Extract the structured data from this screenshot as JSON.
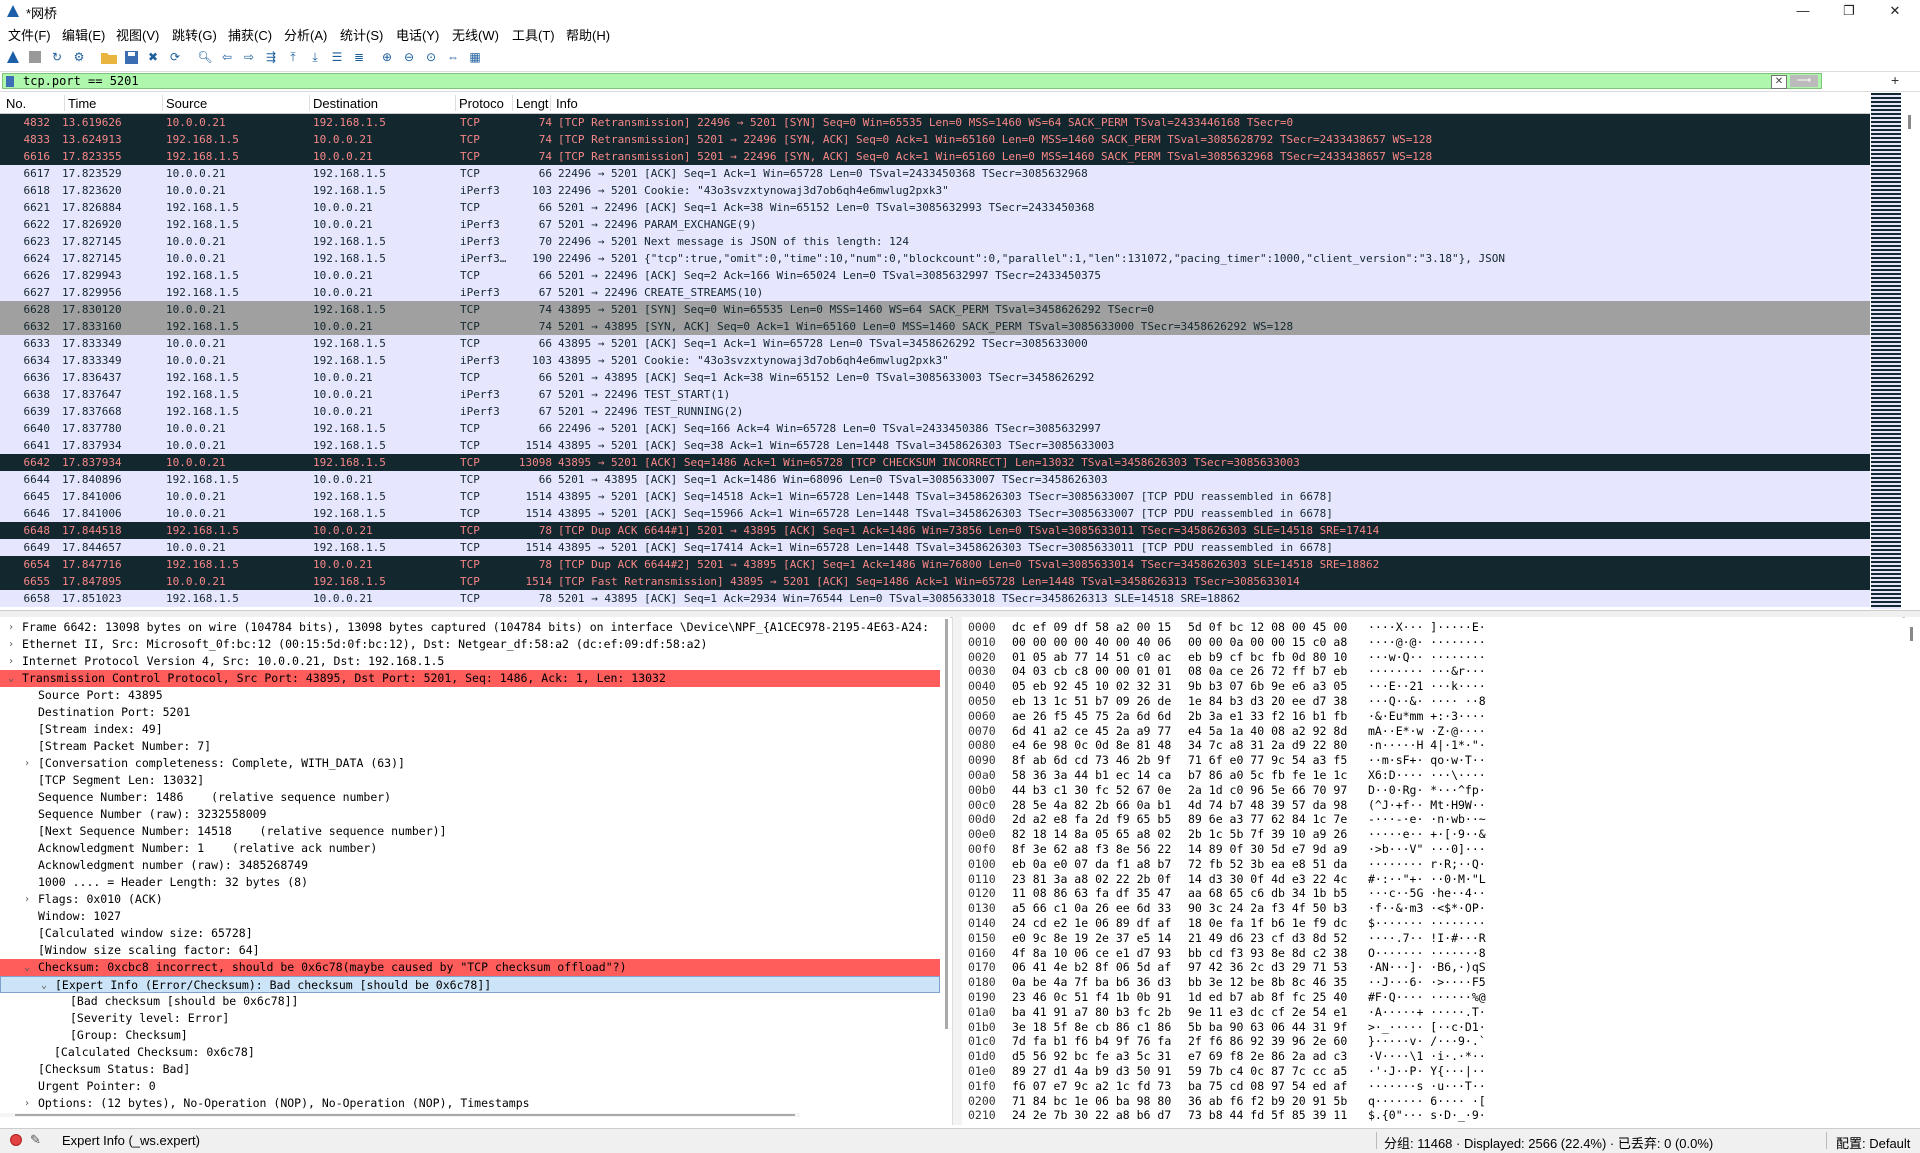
{
  "window": {
    "title": "*网桥",
    "minimize": "—",
    "maximize": "❐",
    "close": "✕"
  },
  "menu": [
    "文件(F)",
    "编辑(E)",
    "视图(V)",
    "跳转(G)",
    "捕获(C)",
    "分析(A)",
    "统计(S)",
    "电话(Y)",
    "无线(W)",
    "工具(T)",
    "帮助(H)"
  ],
  "toolbar_icons": [
    "shark-fin-start-icon",
    "stop-icon",
    "restart-icon",
    "options-gear-icon",
    "open-folder-icon",
    "save-icon",
    "close-file-icon",
    "reload-icon",
    "find-icon",
    "back-icon",
    "forward-icon",
    "go-to-packet-icon",
    "first-packet-icon",
    "last-packet-icon",
    "autoscroll-icon",
    "colorize-icon",
    "zoom-in-icon",
    "zoom-out-icon",
    "zoom-reset-icon",
    "resize-columns-icon",
    "layout-icon"
  ],
  "filter": {
    "value": "tcp.port == 5201",
    "clear": "✕",
    "apply": "⟶",
    "add": "+"
  },
  "columns": {
    "no": "No.",
    "time": "Time",
    "source": "Source",
    "destination": "Destination",
    "protocol": "Protoco",
    "length": "Lengt",
    "info": "Info"
  },
  "packets": [
    {
      "no": "4832",
      "time": "13.619626",
      "src": "10.0.0.21",
      "dst": "192.168.1.5",
      "proto": "TCP",
      "len": "74",
      "info": "[TCP Retransmission] 22496 → 5201 [SYN] Seq=0 Win=65535 Len=0 MSS=1460 WS=64 SACK_PERM TSval=2433446168 TSecr=0",
      "style": "bad"
    },
    {
      "no": "4833",
      "time": "13.624913",
      "src": "192.168.1.5",
      "dst": "10.0.0.21",
      "proto": "TCP",
      "len": "74",
      "info": "[TCP Retransmission] 5201 → 22496 [SYN, ACK] Seq=0 Ack=1 Win=65160 Len=0 MSS=1460 SACK_PERM TSval=3085628792 TSecr=2433438657 WS=128",
      "style": "bad"
    },
    {
      "no": "6616",
      "time": "17.823355",
      "src": "192.168.1.5",
      "dst": "10.0.0.21",
      "proto": "TCP",
      "len": "74",
      "info": "[TCP Retransmission] 5201 → 22496 [SYN, ACK] Seq=0 Ack=1 Win=65160 Len=0 MSS=1460 SACK_PERM TSval=3085632968 TSecr=2433438657 WS=128",
      "style": "bad"
    },
    {
      "no": "6617",
      "time": "17.823529",
      "src": "10.0.0.21",
      "dst": "192.168.1.5",
      "proto": "TCP",
      "len": "66",
      "info": "22496 → 5201 [ACK] Seq=1 Ack=1 Win=65728 Len=0 TSval=2433450368 TSecr=3085632968",
      "style": "tcp"
    },
    {
      "no": "6618",
      "time": "17.823620",
      "src": "10.0.0.21",
      "dst": "192.168.1.5",
      "proto": "iPerf3",
      "len": "103",
      "info": "22496 → 5201 Cookie: \"43o3svzxtynowaj3d7ob6qh4e6mwlug2pxk3\"",
      "style": "tcp"
    },
    {
      "no": "6621",
      "time": "17.826884",
      "src": "192.168.1.5",
      "dst": "10.0.0.21",
      "proto": "TCP",
      "len": "66",
      "info": "5201 → 22496 [ACK] Seq=1 Ack=38 Win=65152 Len=0 TSval=3085632993 TSecr=2433450368",
      "style": "tcp"
    },
    {
      "no": "6622",
      "time": "17.826920",
      "src": "192.168.1.5",
      "dst": "10.0.0.21",
      "proto": "iPerf3",
      "len": "67",
      "info": "5201 → 22496 PARAM_EXCHANGE(9)",
      "style": "tcp"
    },
    {
      "no": "6623",
      "time": "17.827145",
      "src": "10.0.0.21",
      "dst": "192.168.1.5",
      "proto": "iPerf3",
      "len": "70",
      "info": "22496 → 5201 Next message is JSON of this length: 124",
      "style": "tcp"
    },
    {
      "no": "6624",
      "time": "17.827145",
      "src": "10.0.0.21",
      "dst": "192.168.1.5",
      "proto": "iPerf3…",
      "len": "190",
      "info": "22496 → 5201 {\"tcp\":true,\"omit\":0,\"time\":10,\"num\":0,\"blockcount\":0,\"parallel\":1,\"len\":131072,\"pacing_timer\":1000,\"client_version\":\"3.18\"}, JSON",
      "style": "tcp"
    },
    {
      "no": "6626",
      "time": "17.829943",
      "src": "192.168.1.5",
      "dst": "10.0.0.21",
      "proto": "TCP",
      "len": "66",
      "info": "5201 → 22496 [ACK] Seq=2 Ack=166 Win=65024 Len=0 TSval=3085632997 TSecr=2433450375",
      "style": "tcp"
    },
    {
      "no": "6627",
      "time": "17.829956",
      "src": "192.168.1.5",
      "dst": "10.0.0.21",
      "proto": "iPerf3",
      "len": "67",
      "info": "5201 → 22496 CREATE_STREAMS(10)",
      "style": "tcp"
    },
    {
      "no": "6628",
      "time": "17.830120",
      "src": "10.0.0.21",
      "dst": "192.168.1.5",
      "proto": "TCP",
      "len": "74",
      "info": "43895 → 5201 [SYN] Seq=0 Win=65535 Len=0 MSS=1460 WS=64 SACK_PERM TSval=3458626292 TSecr=0",
      "style": "syn"
    },
    {
      "no": "6632",
      "time": "17.833160",
      "src": "192.168.1.5",
      "dst": "10.0.0.21",
      "proto": "TCP",
      "len": "74",
      "info": "5201 → 43895 [SYN, ACK] Seq=0 Ack=1 Win=65160 Len=0 MSS=1460 SACK_PERM TSval=3085633000 TSecr=3458626292 WS=128",
      "style": "syn"
    },
    {
      "no": "6633",
      "time": "17.833349",
      "src": "10.0.0.21",
      "dst": "192.168.1.5",
      "proto": "TCP",
      "len": "66",
      "info": "43895 → 5201 [ACK] Seq=1 Ack=1 Win=65728 Len=0 TSval=3458626292 TSecr=3085633000",
      "style": "tcp"
    },
    {
      "no": "6634",
      "time": "17.833349",
      "src": "10.0.0.21",
      "dst": "192.168.1.5",
      "proto": "iPerf3",
      "len": "103",
      "info": "43895 → 5201 Cookie: \"43o3svzxtynowaj3d7ob6qh4e6mwlug2pxk3\"",
      "style": "tcp"
    },
    {
      "no": "6636",
      "time": "17.836437",
      "src": "192.168.1.5",
      "dst": "10.0.0.21",
      "proto": "TCP",
      "len": "66",
      "info": "5201 → 43895 [ACK] Seq=1 Ack=38 Win=65152 Len=0 TSval=3085633003 TSecr=3458626292",
      "style": "tcp"
    },
    {
      "no": "6638",
      "time": "17.837647",
      "src": "192.168.1.5",
      "dst": "10.0.0.21",
      "proto": "iPerf3",
      "len": "67",
      "info": "5201 → 22496 TEST_START(1)",
      "style": "tcp"
    },
    {
      "no": "6639",
      "time": "17.837668",
      "src": "192.168.1.5",
      "dst": "10.0.0.21",
      "proto": "iPerf3",
      "len": "67",
      "info": "5201 → 22496 TEST_RUNNING(2)",
      "style": "tcp"
    },
    {
      "no": "6640",
      "time": "17.837780",
      "src": "10.0.0.21",
      "dst": "192.168.1.5",
      "proto": "TCP",
      "len": "66",
      "info": "22496 → 5201 [ACK] Seq=166 Ack=4 Win=65728 Len=0 TSval=2433450386 TSecr=3085632997",
      "style": "tcp"
    },
    {
      "no": "6641",
      "time": "17.837934",
      "src": "10.0.0.21",
      "dst": "192.168.1.5",
      "proto": "TCP",
      "len": "1514",
      "info": "43895 → 5201 [ACK] Seq=38 Ack=1 Win=65728 Len=1448 TSval=3458626303 TSecr=3085633003",
      "style": "tcp"
    },
    {
      "no": "6642",
      "time": "17.837934",
      "src": "10.0.0.21",
      "dst": "192.168.1.5",
      "proto": "TCP",
      "len": "13098",
      "info": "43895 → 5201 [ACK] Seq=1486 Ack=1 Win=65728 [TCP CHECKSUM INCORRECT] Len=13032 TSval=3458626303 TSecr=3085633003",
      "style": "bad"
    },
    {
      "no": "6644",
      "time": "17.840896",
      "src": "192.168.1.5",
      "dst": "10.0.0.21",
      "proto": "TCP",
      "len": "66",
      "info": "5201 → 43895 [ACK] Seq=1 Ack=1486 Win=68096 Len=0 TSval=3085633007 TSecr=3458626303",
      "style": "tcp"
    },
    {
      "no": "6645",
      "time": "17.841006",
      "src": "10.0.0.21",
      "dst": "192.168.1.5",
      "proto": "TCP",
      "len": "1514",
      "info": "43895 → 5201 [ACK] Seq=14518 Ack=1 Win=65728 Len=1448 TSval=3458626303 TSecr=3085633007 [TCP PDU reassembled in 6678]",
      "style": "tcp"
    },
    {
      "no": "6646",
      "time": "17.841006",
      "src": "10.0.0.21",
      "dst": "192.168.1.5",
      "proto": "TCP",
      "len": "1514",
      "info": "43895 → 5201 [ACK] Seq=15966 Ack=1 Win=65728 Len=1448 TSval=3458626303 TSecr=3085633007 [TCP PDU reassembled in 6678]",
      "style": "tcp"
    },
    {
      "no": "6648",
      "time": "17.844518",
      "src": "192.168.1.5",
      "dst": "10.0.0.21",
      "proto": "TCP",
      "len": "78",
      "info": "[TCP Dup ACK 6644#1] 5201 → 43895 [ACK] Seq=1 Ack=1486 Win=73856 Len=0 TSval=3085633011 TSecr=3458626303 SLE=14518 SRE=17414",
      "style": "bad"
    },
    {
      "no": "6649",
      "time": "17.844657",
      "src": "10.0.0.21",
      "dst": "192.168.1.5",
      "proto": "TCP",
      "len": "1514",
      "info": "43895 → 5201 [ACK] Seq=17414 Ack=1 Win=65728 Len=1448 TSval=3458626303 TSecr=3085633011 [TCP PDU reassembled in 6678]",
      "style": "tcp"
    },
    {
      "no": "6654",
      "time": "17.847716",
      "src": "192.168.1.5",
      "dst": "10.0.0.21",
      "proto": "TCP",
      "len": "78",
      "info": "[TCP Dup ACK 6644#2] 5201 → 43895 [ACK] Seq=1 Ack=1486 Win=76800 Len=0 TSval=3085633014 TSecr=3458626303 SLE=14518 SRE=18862",
      "style": "bad"
    },
    {
      "no": "6655",
      "time": "17.847895",
      "src": "10.0.0.21",
      "dst": "192.168.1.5",
      "proto": "TCP",
      "len": "1514",
      "info": "[TCP Fast Retransmission] 43895 → 5201 [ACK] Seq=1486 Ack=1 Win=65728 Len=1448 TSval=3458626313 TSecr=3085633014",
      "style": "bad"
    },
    {
      "no": "6658",
      "time": "17.851023",
      "src": "192.168.1.5",
      "dst": "10.0.0.21",
      "proto": "TCP",
      "len": "78",
      "info": "5201 → 43895 [ACK] Seq=1 Ack=2934 Win=76544 Len=0 TSval=3085633018 TSecr=3458626313 SLE=14518 SRE=18862",
      "style": "tcp"
    }
  ],
  "tree": [
    {
      "arrow": "›",
      "indent": 0,
      "text": "Frame 6642: 13098 bytes on wire (104784 bits), 13098 bytes captured (104784 bits) on interface \\Device\\NPF_{A1CEC978-2195-4E63-A24:",
      "style": ""
    },
    {
      "arrow": "›",
      "indent": 0,
      "text": "Ethernet II, Src: Microsoft_0f:bc:12 (00:15:5d:0f:bc:12), Dst: Netgear_df:58:a2 (dc:ef:09:df:58:a2)",
      "style": ""
    },
    {
      "arrow": "›",
      "indent": 0,
      "text": "Internet Protocol Version 4, Src: 10.0.0.21, Dst: 192.168.1.5",
      "style": ""
    },
    {
      "arrow": "⌄",
      "indent": 0,
      "text": "Transmission Control Protocol, Src Port: 43895, Dst Port: 5201, Seq: 1486, Ack: 1, Len: 13032",
      "style": "err"
    },
    {
      "arrow": "",
      "indent": 1,
      "text": "Source Port: 43895",
      "style": ""
    },
    {
      "arrow": "",
      "indent": 1,
      "text": "Destination Port: 5201",
      "style": ""
    },
    {
      "arrow": "",
      "indent": 1,
      "text": "[Stream index: 49]",
      "style": ""
    },
    {
      "arrow": "",
      "indent": 1,
      "text": "[Stream Packet Number: 7]",
      "style": ""
    },
    {
      "arrow": "›",
      "indent": 1,
      "text": "[Conversation completeness: Complete, WITH_DATA (63)]",
      "style": ""
    },
    {
      "arrow": "",
      "indent": 1,
      "text": "[TCP Segment Len: 13032]",
      "style": ""
    },
    {
      "arrow": "",
      "indent": 1,
      "text": "Sequence Number: 1486    (relative sequence number)",
      "style": ""
    },
    {
      "arrow": "",
      "indent": 1,
      "text": "Sequence Number (raw): 3232558009",
      "style": ""
    },
    {
      "arrow": "",
      "indent": 1,
      "text": "[Next Sequence Number: 14518    (relative sequence number)]",
      "style": ""
    },
    {
      "arrow": "",
      "indent": 1,
      "text": "Acknowledgment Number: 1    (relative ack number)",
      "style": ""
    },
    {
      "arrow": "",
      "indent": 1,
      "text": "Acknowledgment number (raw): 3485268749",
      "style": ""
    },
    {
      "arrow": "",
      "indent": 1,
      "text": "1000 .... = Header Length: 32 bytes (8)",
      "style": ""
    },
    {
      "arrow": "›",
      "indent": 1,
      "text": "Flags: 0x010 (ACK)",
      "style": ""
    },
    {
      "arrow": "",
      "indent": 1,
      "text": "Window: 1027",
      "style": ""
    },
    {
      "arrow": "",
      "indent": 1,
      "text": "[Calculated window size: 65728]",
      "style": ""
    },
    {
      "arrow": "",
      "indent": 1,
      "text": "[Window size scaling factor: 64]",
      "style": ""
    },
    {
      "arrow": "⌄",
      "indent": 1,
      "text": "Checksum: 0xcbc8 incorrect, should be 0x6c78(maybe caused by \"TCP checksum offload\"?)",
      "style": "err"
    },
    {
      "arrow": "⌄",
      "indent": 2,
      "text": "[Expert Info (Error/Checksum): Bad checksum [should be 0x6c78]]",
      "style": "sel"
    },
    {
      "arrow": "",
      "indent": 3,
      "text": "[Bad checksum [should be 0x6c78]]",
      "style": ""
    },
    {
      "arrow": "",
      "indent": 3,
      "text": "[Severity level: Error]",
      "style": ""
    },
    {
      "arrow": "",
      "indent": 3,
      "text": "[Group: Checksum]",
      "style": ""
    },
    {
      "arrow": "",
      "indent": 2,
      "text": "[Calculated Checksum: 0x6c78]",
      "style": ""
    },
    {
      "arrow": "",
      "indent": 1,
      "text": "[Checksum Status: Bad]",
      "style": ""
    },
    {
      "arrow": "",
      "indent": 1,
      "text": "Urgent Pointer: 0",
      "style": ""
    },
    {
      "arrow": "›",
      "indent": 1,
      "text": "Options: (12 bytes), No-Operation (NOP), No-Operation (NOP), Timestamps",
      "style": ""
    }
  ],
  "hex": [
    {
      "off": "0000",
      "b1": "dc ef 09 df 58 a2 00 15",
      "b2": "5d 0f bc 12 08 00 45 00",
      "asc": "····X··· ]·····E·"
    },
    {
      "off": "0010",
      "b1": "00 00 00 00 40 00 40 06",
      "b2": "00 00 0a 00 00 15 c0 a8",
      "asc": "····@·@· ········"
    },
    {
      "off": "0020",
      "b1": "01 05 ab 77 14 51 c0 ac",
      "b2": "eb b9 cf bc fb 0d 80 10",
      "asc": "···w·Q·· ········"
    },
    {
      "off": "0030",
      "b1": "04 03 cb c8 00 00 01 01",
      "b2": "08 0a ce 26 72 ff b7 eb",
      "asc": "········ ···&r···"
    },
    {
      "off": "0040",
      "b1": "05 eb 92 45 10 02 32 31",
      "b2": "9b b3 07 6b 9e e6 a3 05",
      "asc": "···E··21 ···k····"
    },
    {
      "off": "0050",
      "b1": "eb 13 1c 51 b7 09 26 de",
      "b2": "1e 84 b3 d3 20 ee d7 38",
      "asc": "···Q··&· ···· ··8"
    },
    {
      "off": "0060",
      "b1": "ae 26 f5 45 75 2a 6d 6d",
      "b2": "2b 3a e1 33 f2 16 b1 fb",
      "asc": "·&·Eu*mm +:·3····"
    },
    {
      "off": "0070",
      "b1": "6d 41 a2 ce 45 2a a9 77",
      "b2": "e4 5a 1a 40 08 a2 92 8d",
      "asc": "mA··E*·w ·Z·@····"
    },
    {
      "off": "0080",
      "b1": "e4 6e 98 0c 0d 8e 81 48",
      "b2": "34 7c a8 31 2a d9 22 80",
      "asc": "·n·····H 4|·1*·\"·"
    },
    {
      "off": "0090",
      "b1": "8f ab 6d cd 73 46 2b 9f",
      "b2": "71 6f e0 77 9c 54 a3 f5",
      "asc": "··m·sF+· qo·w·T··"
    },
    {
      "off": "00a0",
      "b1": "58 36 3a 44 b1 ec 14 ca",
      "b2": "b7 86 a0 5c fb fe 1e 1c",
      "asc": "X6:D···· ···\\····"
    },
    {
      "off": "00b0",
      "b1": "44 b3 c1 30 fc 52 67 0e",
      "b2": "2a 1d c0 96 5e 66 70 97",
      "asc": "D··0·Rg· *···^fp·"
    },
    {
      "off": "00c0",
      "b1": "28 5e 4a 82 2b 66 0a b1",
      "b2": "4d 74 b7 48 39 57 da 98",
      "asc": "(^J·+f·· Mt·H9W··"
    },
    {
      "off": "00d0",
      "b1": "2d a2 e8 fa 2d f9 65 b5",
      "b2": "89 6e a3 77 62 84 1c 7e",
      "asc": "-···-·e· ·n·wb··~"
    },
    {
      "off": "00e0",
      "b1": "82 18 14 8a 05 65 a8 02",
      "b2": "2b 1c 5b 7f 39 10 a9 26",
      "asc": "·····e·· +·[·9··&"
    },
    {
      "off": "00f0",
      "b1": "8f 3e 62 a8 f3 8e 56 22",
      "b2": "14 89 0f 30 5d e7 9d a9",
      "asc": "·>b···V\" ···0]···"
    },
    {
      "off": "0100",
      "b1": "eb 0a e0 07 da f1 a8 b7",
      "b2": "72 fb 52 3b ea e8 51 da",
      "asc": "········ r·R;··Q·"
    },
    {
      "off": "0110",
      "b1": "23 81 3a a8 02 22 2b 0f",
      "b2": "14 d3 30 0f 4d e3 22 4c",
      "asc": "#·:··\"+· ··0·M·\"L"
    },
    {
      "off": "0120",
      "b1": "11 08 86 63 fa df 35 47",
      "b2": "aa 68 65 c6 db 34 1b b5",
      "asc": "···c··5G ·he··4··"
    },
    {
      "off": "0130",
      "b1": "a5 66 c1 0a 26 ee 6d 33",
      "b2": "90 3c 24 2a f3 4f 50 b3",
      "asc": "·f··&·m3 ·<$*·OP·"
    },
    {
      "off": "0140",
      "b1": "24 cd e2 1e 06 89 df af",
      "b2": "18 0e fa 1f b6 1e f9 dc",
      "asc": "$······· ········"
    },
    {
      "off": "0150",
      "b1": "e0 9c 8e 19 2e 37 e5 14",
      "b2": "21 49 d6 23 cf d3 8d 52",
      "asc": "····.7·· !I·#···R"
    },
    {
      "off": "0160",
      "b1": "4f 8a 10 06 ce e1 d7 93",
      "b2": "bb cd f3 93 8e 8d c2 38",
      "asc": "O······· ·······8"
    },
    {
      "off": "0170",
      "b1": "06 41 4e b2 8f 06 5d af",
      "b2": "97 42 36 2c d3 29 71 53",
      "asc": "·AN···]· ·B6,·)qS"
    },
    {
      "off": "0180",
      "b1": "0a be 4a 7f ba b6 36 d3",
      "b2": "bb 3e 12 be 8b 8c 46 35",
      "asc": "··J···6· ·>····F5"
    },
    {
      "off": "0190",
      "b1": "23 46 0c 51 f4 1b 0b 91",
      "b2": "1d ed b7 ab 8f fc 25 40",
      "asc": "#F·Q···· ······%@"
    },
    {
      "off": "01a0",
      "b1": "ba 41 91 a7 80 b3 fc 2b",
      "b2": "9e 11 e3 dc cf 2e 54 e1",
      "asc": "·A·····+ ·····.T·"
    },
    {
      "off": "01b0",
      "b1": "3e 18 5f 8e cb 86 c1 86",
      "b2": "5b ba 90 63 06 44 31 9f",
      "asc": ">·_····· [··c·D1·"
    },
    {
      "off": "01c0",
      "b1": "7d fa b1 f6 b4 9f 76 fa",
      "b2": "2f f6 86 92 39 96 2e 60",
      "asc": "}·····v· /···9·.`"
    },
    {
      "off": "01d0",
      "b1": "d5 56 92 bc fe a3 5c 31",
      "b2": "e7 69 f8 2e 86 2a ad c3",
      "asc": "·V····\\1 ·i·.·*··"
    },
    {
      "off": "01e0",
      "b1": "89 27 d1 4a b9 d3 50 91",
      "b2": "59 7b c4 0c 87 7c cc a5",
      "asc": "·'·J··P· Y{···|··"
    },
    {
      "off": "01f0",
      "b1": "f6 07 e7 9c a2 1c fd 73",
      "b2": "ba 75 cd 08 97 54 ed af",
      "asc": "·······s ·u···T··"
    },
    {
      "off": "0200",
      "b1": "71 84 bc 1e 06 ba 98 80",
      "b2": "36 ab f6 f2 b9 20 91 5b",
      "asc": "q······· 6···· ·["
    },
    {
      "off": "0210",
      "b1": "24 2e 7b 30 22 a8 b6 d7",
      "b2": "73 b8 44 fd 5f 85 39 11",
      "asc": "$.{0\"··· s·D·_·9·"
    }
  ],
  "status": {
    "expert": "Expert Info (_ws.expert)",
    "stats": "分组: 11468 · Displayed: 2566 (22.4%) · 已丢弃: 0 (0.0%)",
    "profile": "配置: Default",
    "edit": "✎"
  }
}
